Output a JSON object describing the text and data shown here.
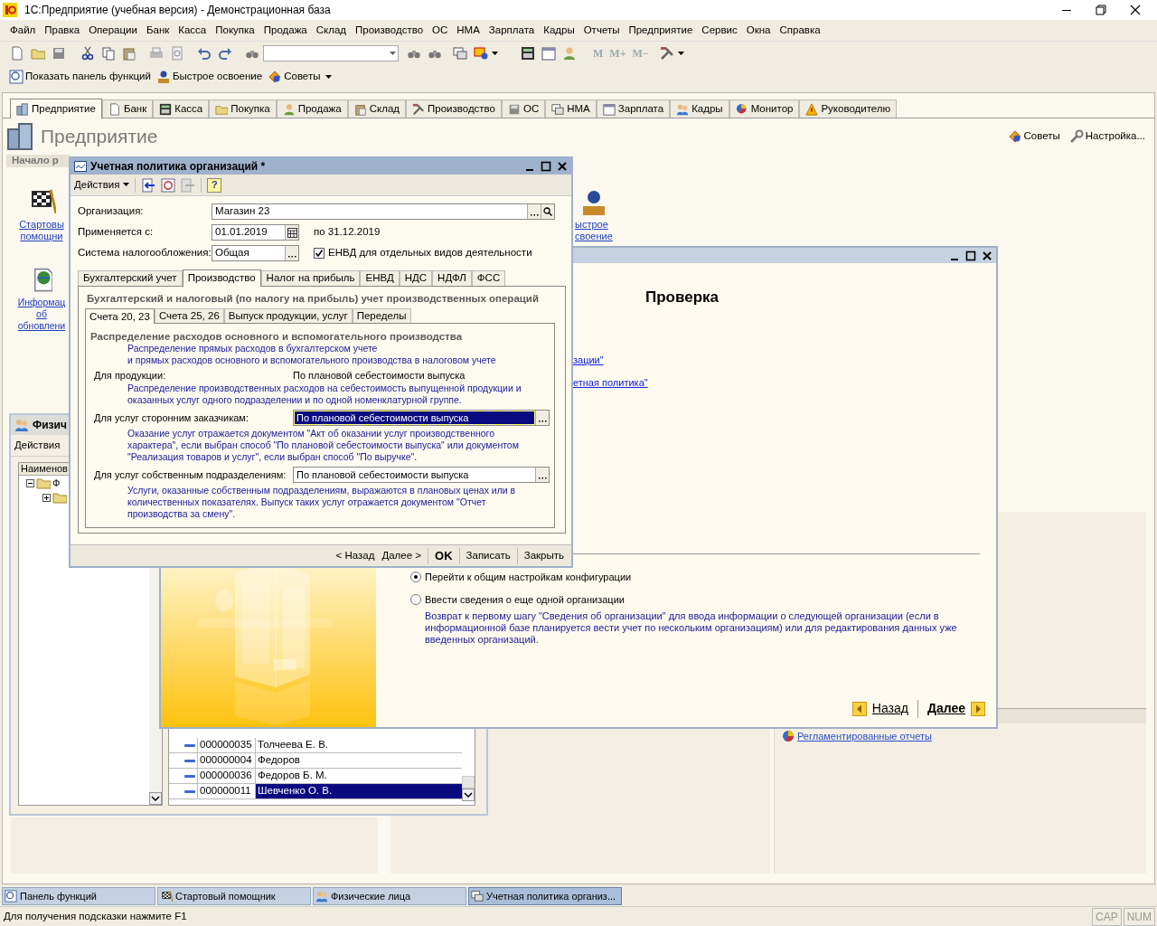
{
  "window": {
    "title": "1С:Предприятие (учебная версия) - Демонстрационная база"
  },
  "menu": [
    "Файл",
    "Правка",
    "Операции",
    "Банк",
    "Касса",
    "Покупка",
    "Продажа",
    "Склад",
    "Производство",
    "ОС",
    "НМА",
    "Зарплата",
    "Кадры",
    "Отчеты",
    "Предприятие",
    "Сервис",
    "Окна",
    "Справка"
  ],
  "memory_buttons": [
    "M",
    "M+",
    "M−"
  ],
  "panel_toolbar": [
    "Показать панель функций",
    "Быстрое освоение",
    "Советы"
  ],
  "sections": {
    "tabs": [
      {
        "label": "Предприятие",
        "selected": true
      },
      {
        "label": "Банк",
        "selected": false
      },
      {
        "label": "Касса",
        "selected": false
      },
      {
        "label": "Покупка",
        "selected": false
      },
      {
        "label": "Продажа",
        "selected": false
      },
      {
        "label": "Склад",
        "selected": false
      },
      {
        "label": "Производство",
        "selected": false
      },
      {
        "label": "ОС",
        "selected": false
      },
      {
        "label": "НМА",
        "selected": false
      },
      {
        "label": "Зарплата",
        "selected": false
      },
      {
        "label": "Кадры",
        "selected": false
      },
      {
        "label": "Монитор",
        "selected": false
      },
      {
        "label": "Руководителю",
        "selected": false
      }
    ],
    "title": "Предприятие",
    "right_links": [
      "Советы",
      "Настройка..."
    ],
    "group_label": "Начало р",
    "start_links": [
      {
        "lines": [
          "Стартовы",
          "помощни"
        ]
      },
      {
        "lines": [
          "Информац",
          "об",
          "обновлени"
        ]
      }
    ],
    "quick_link": {
      "lines": [
        "ыстрое",
        "своение"
      ]
    },
    "reports_link": "Регламентированные отчеты"
  },
  "persons_window": {
    "title": "Физич",
    "actions": "Действия",
    "tree_header": "Наименов",
    "tree": [
      {
        "label": "Ф",
        "expanded": true,
        "children": [
          {
            "expanded": false
          }
        ]
      }
    ],
    "rows": [
      {
        "code": "000000035",
        "name": "Толчеева Е. В.",
        "selected": false
      },
      {
        "code": "000000004",
        "name": "Федоров",
        "selected": false
      },
      {
        "code": "000000036",
        "name": "Федоров Б. М.",
        "selected": false
      },
      {
        "code": "000000011",
        "name": "Шевченко О. В.",
        "selected": true
      }
    ]
  },
  "wizard": {
    "heading": "Проверка",
    "links": [
      "зации\"",
      "етная политика\""
    ],
    "options": [
      {
        "label": "Перейти к общим настройкам конфигурации",
        "selected": true
      },
      {
        "label": "Ввести сведения о еще одной организации",
        "selected": false,
        "description": "Возврат к первому шагу \"Сведения об организации\" для ввода информации о следующей организации (если в информационной базе планируется вести учет по нескольким организациям) или для редактирования данных уже введенных организаций."
      }
    ],
    "back": "Назад",
    "next": "Далее"
  },
  "policy_dialog": {
    "title": "Учетная политика организаций *",
    "actions": "Действия",
    "help": "?",
    "organization": {
      "label": "Организация:",
      "value": "Магазин 23"
    },
    "start": {
      "label": "Применяется с:",
      "value": "01.01.2019",
      "until": "по 31.12.2019"
    },
    "tax_system": {
      "label": "Система налогообложения:",
      "value": "Общая"
    },
    "envd": {
      "label": "ЕНВД для отдельных видов деятельности",
      "checked": true
    },
    "tabs": [
      {
        "label": "Бухгалтерский учет",
        "selected": false
      },
      {
        "label": "Производство",
        "selected": true
      },
      {
        "label": "Налог на прибыль",
        "selected": false
      },
      {
        "label": "ЕНВД",
        "selected": false
      },
      {
        "label": "НДС",
        "selected": false
      },
      {
        "label": "НДФЛ",
        "selected": false
      },
      {
        "label": "ФСС",
        "selected": false
      }
    ],
    "section_title": "Бухгалтерский и налоговый (по налогу на прибыль) учет производственных операций",
    "subtabs": [
      {
        "label": "Счета 20, 23",
        "selected": true
      },
      {
        "label": "Счета 25, 26",
        "selected": false
      },
      {
        "label": "Выпуск продукции, услуг",
        "selected": false
      },
      {
        "label": "Переделы",
        "selected": false
      }
    ],
    "group_title": "Распределение расходов основного и вспомогательного производства",
    "items": [
      {
        "kind": "note",
        "text": "Распределение прямых расходов в бухгалтерском учете\nи прямых расходов основного и вспомогательного производства в налоговом учете"
      },
      {
        "kind": "setting",
        "label": "Для продукции:",
        "value": "По плановой себестоимости выпуска"
      },
      {
        "kind": "note",
        "text": "Распределение производственных расходов на себестоимость выпущенной продукции и\nоказанных услуг одного подразделении и по одной номенклатурной группе."
      },
      {
        "kind": "select",
        "label": "Для услуг сторонним заказчикам:",
        "value": "По плановой себестоимости выпуска",
        "focused": true
      },
      {
        "kind": "note",
        "text": "Оказание услуг отражается документом \"Акт об оказании услуг производственного\nхарактера\", если выбран способ \"По плановой себестоимости выпуска\" или документом\n\"Реализация товаров и услуг\", если выбран способ \"По выручке\"."
      },
      {
        "kind": "select",
        "label": "Для услуг собственным подразделениям:",
        "value": "По плановой себестоимости выпуска",
        "focused": false
      },
      {
        "kind": "note",
        "text": "Услуги, оказанные собственным подразделениям, выражаются в плановых ценах или в\nколичественных показателях. Выпуск таких услуг отражается документом \"Отчет\nпроизводства за смену\"."
      }
    ],
    "buttons": [
      {
        "label": "< Назад",
        "default": false
      },
      {
        "label": "Далее >",
        "default": false
      },
      {
        "label": "OK",
        "default": true
      },
      {
        "label": "Записать",
        "default": false
      },
      {
        "label": "Закрыть",
        "default": false
      }
    ]
  },
  "taskbar": [
    {
      "label": "Панель функций",
      "active": false
    },
    {
      "label": "Стартовый помощник",
      "active": false
    },
    {
      "label": "Физические лица",
      "active": false
    },
    {
      "label": "Учетная политика организ...",
      "active": true
    }
  ],
  "status_bar": {
    "hint": "Для получения подсказки нажмите F1",
    "indicators": [
      "CAP",
      "NUM"
    ]
  }
}
